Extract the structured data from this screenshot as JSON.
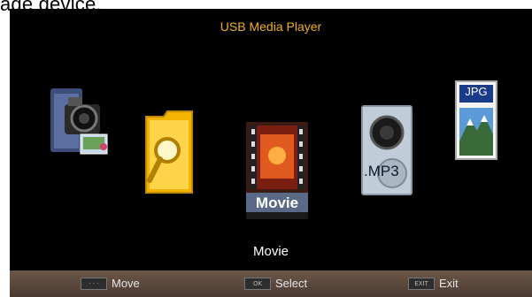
{
  "page_fragment": "age device.",
  "player": {
    "title": "USB Media Player",
    "selected_label": "Movie"
  },
  "icons": {
    "movie_badge": "Movie",
    "music_badge": ".MP3",
    "photo_badge": "JPG"
  },
  "footer": {
    "move_key": "· · ·",
    "move_label": "Move",
    "select_key": "OK",
    "select_label": "Select",
    "exit_key": "EXIT",
    "exit_label": "Exit"
  },
  "colors": {
    "title": "#f0b020",
    "footer": "#5a4a3c"
  }
}
